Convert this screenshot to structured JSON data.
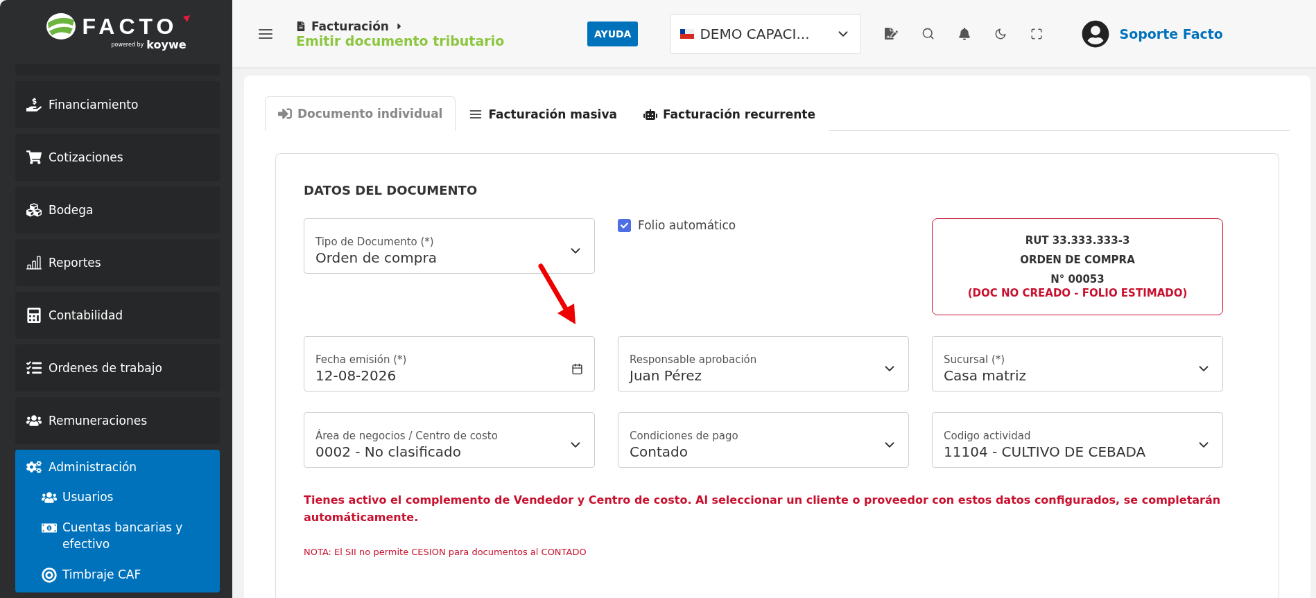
{
  "sidebar": {
    "logo": {
      "name": "FACTO",
      "powered": "powered by",
      "brand": "koywe"
    },
    "items": [
      {
        "label": "Financiamiento",
        "kind": "hand-dollar",
        "selected": false
      },
      {
        "label": "Cotizaciones",
        "kind": "cart",
        "selected": false
      },
      {
        "label": "Bodega",
        "kind": "boxes",
        "selected": false
      },
      {
        "label": "Reportes",
        "kind": "chart",
        "selected": false
      },
      {
        "label": "Contabilidad",
        "kind": "calculator",
        "selected": false
      },
      {
        "label": "Ordenes de trabajo",
        "kind": "tasks",
        "selected": false
      },
      {
        "label": "Remuneraciones",
        "kind": "users",
        "selected": false
      },
      {
        "label": "Administración",
        "kind": "gears",
        "selected": true,
        "children": [
          {
            "label": "Usuarios",
            "kind": "users"
          },
          {
            "label": "Cuentas bancarias y efectivo",
            "kind": "money"
          },
          {
            "label": "Timbraje CAF",
            "kind": "target"
          }
        ]
      }
    ]
  },
  "header": {
    "section": "Facturación",
    "page": "Emitir documento tributario",
    "help": "AYUDA",
    "company": "DEMO CAPACI...",
    "user": "Soporte Facto"
  },
  "tabs": [
    {
      "label": "Documento individual",
      "kind": "login",
      "selected": true
    },
    {
      "label": "Facturación masiva",
      "kind": "lines",
      "selected": false
    },
    {
      "label": "Facturación recurrente",
      "kind": "robot",
      "selected": false
    }
  ],
  "form": {
    "title": "DATOS DEL DOCUMENTO",
    "folio": {
      "label": "Folio automático",
      "checked": true
    },
    "summary": {
      "lines": [
        "RUT 33.333.333-3",
        "ORDEN DE COMPRA",
        "N° 00053"
      ],
      "warning": "(DOC NO CREADO - FOLIO ESTIMADO)"
    },
    "fields": [
      {
        "label": "Tipo de Documento (*)",
        "value": "Orden de compra",
        "kind": "select"
      },
      {
        "label": "Fecha emisión (*)",
        "value": "12-08-2026",
        "kind": "date"
      },
      {
        "label": "Responsable aprobación",
        "value": "Juan Pérez",
        "kind": "select"
      },
      {
        "label": "Sucursal (*)",
        "value": "Casa matriz",
        "kind": "select"
      },
      {
        "label": "Área de negocios / Centro de costo",
        "value": "0002 - No clasificado",
        "kind": "select"
      },
      {
        "label": "Condiciones de pago",
        "value": "Contado",
        "kind": "select"
      },
      {
        "label": "Codigo actividad",
        "value": "11104 - CULTIVO DE CEBADA",
        "kind": "select"
      }
    ],
    "notice": "Tienes activo el complemento de Vendedor y Centro de costo. Al seleccionar un cliente o proveedor con estos datos configurados, se completarán automáticamente.",
    "note": "NOTA: El SII no permite CESION para documentos al CONTADO"
  }
}
